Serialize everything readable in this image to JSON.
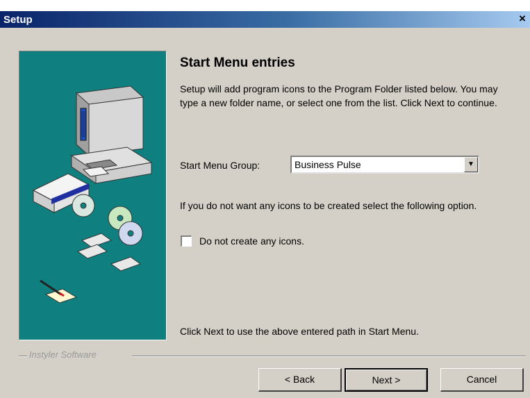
{
  "window": {
    "title": "Setup",
    "close_glyph": "×"
  },
  "page": {
    "heading": "Start Menu entries",
    "description": "Setup will add program icons to the Program Folder listed below. You may type a new folder name, or select one from the list. Click Next to continue.",
    "group_label": "Start Menu Group:",
    "group_value": "Business Pulse",
    "option_text": "If you do not want any icons to be created select the following option.",
    "checkbox_label": "Do not create any icons.",
    "checkbox_checked": false,
    "footer_text": "Click Next to use the above entered path in Start Menu."
  },
  "brand": "Instyler Software",
  "buttons": {
    "back": "< Back",
    "next": "Next >",
    "cancel": "Cancel"
  },
  "colors": {
    "panel_bg": "#0f7f7f",
    "dialog_bg": "#d4d0c8",
    "titlebar": "#0a246a"
  }
}
